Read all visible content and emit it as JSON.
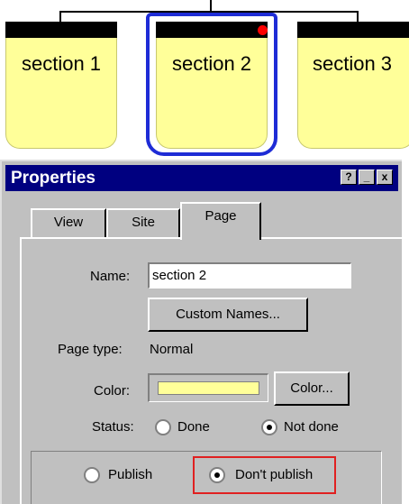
{
  "diagram": {
    "sections": [
      {
        "label": "section 1"
      },
      {
        "label": "section 2"
      },
      {
        "label": "section 3"
      }
    ],
    "selected_index": 1
  },
  "window": {
    "title": "Properties",
    "controls": {
      "help": "?",
      "minimize": "_",
      "close": "x"
    }
  },
  "tabs": [
    {
      "label": "View"
    },
    {
      "label": "Site"
    },
    {
      "label": "Page"
    }
  ],
  "active_tab": "Page",
  "page": {
    "name_label": "Name:",
    "name_value": "section 2",
    "custom_names_button": "Custom Names...",
    "page_type_label": "Page type:",
    "page_type_value": "Normal",
    "color_label": "Color:",
    "color_value": "#ffff99",
    "color_button": "Color...",
    "status_label": "Status:",
    "status_options": [
      {
        "label": "Done",
        "selected": false
      },
      {
        "label": "Not done",
        "selected": true
      }
    ],
    "publish_options": [
      {
        "label": "Publish",
        "selected": false
      },
      {
        "label": "Don't publish",
        "selected": true
      }
    ]
  },
  "colors": {
    "title_bar": "#000080",
    "section_fill": "#ffff99",
    "selection_frame": "#1e2cd6",
    "highlight_box": "#e02020",
    "marker_dot": "#ff0000"
  }
}
